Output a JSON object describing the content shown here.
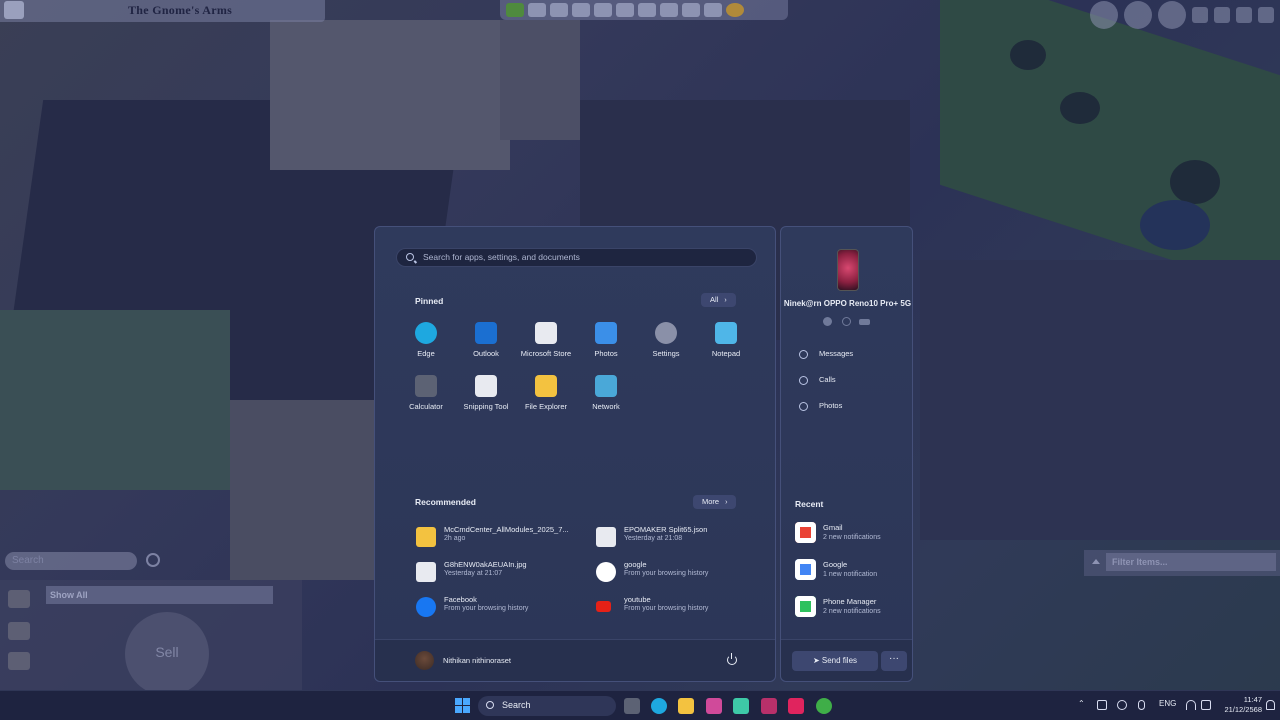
{
  "game": {
    "lot_name": "The Gnome's Arms",
    "search_placeholder": "Search",
    "filter_dropdown": "Show All",
    "sell_label": "Sell",
    "filter_placeholder": "Filter Items..."
  },
  "start_menu": {
    "search_placeholder": "Search for apps, settings, and documents",
    "pinned_title": "Pinned",
    "all_button": "All",
    "pinned_apps": [
      {
        "label": "Edge",
        "icon": "edge-icon",
        "color": "#1ea8e0"
      },
      {
        "label": "Outlook",
        "icon": "outlook-icon",
        "color": "#1b6fd1"
      },
      {
        "label": "Microsoft Store",
        "icon": "store-icon",
        "color": "#e8eaf0"
      },
      {
        "label": "Photos",
        "icon": "photos-icon",
        "color": "#3b8fe8"
      },
      {
        "label": "Settings",
        "icon": "settings-icon",
        "color": "#8a90a8"
      },
      {
        "label": "Notepad",
        "icon": "notepad-icon",
        "color": "#4fb6e8"
      },
      {
        "label": "Calculator",
        "icon": "calculator-icon",
        "color": "#5c6274"
      },
      {
        "label": "Snipping Tool",
        "icon": "snipping-tool-icon",
        "color": "#e8eaf0"
      },
      {
        "label": "File Explorer",
        "icon": "folder-icon",
        "color": "#f3c240"
      },
      {
        "label": "Network",
        "icon": "network-icon",
        "color": "#4aa8d8"
      }
    ],
    "recommended_title": "Recommended",
    "more_button": "More",
    "recommended": [
      {
        "title": "McCmdCenter_AllModules_2025_7...",
        "sub": "2h ago",
        "icon": "folder-icon",
        "color": "#f3c240"
      },
      {
        "title": "EPOMAKER Split65.json",
        "sub": "Yesterday at 21:08",
        "icon": "file-icon",
        "color": "#e8eaf0"
      },
      {
        "title": "G8hENW0akAEUAIn.jpg",
        "sub": "Yesterday at 21:07",
        "icon": "image-file-icon",
        "color": "#e8eaf0"
      },
      {
        "title": "google",
        "sub": "From your browsing history",
        "icon": "google-icon",
        "color": "#ffffff"
      },
      {
        "title": "Facebook",
        "sub": "From your browsing history",
        "icon": "facebook-icon",
        "color": "#1877f2"
      },
      {
        "title": "youtube",
        "sub": "From your browsing history",
        "icon": "youtube-icon",
        "color": "#e62117"
      }
    ],
    "user_name": "Nithikan nithinoraset"
  },
  "phone": {
    "device_name": "Ninek@rn OPPO Reno10 Pro+ 5G",
    "links": [
      {
        "label": "Messages",
        "icon": "messages-icon"
      },
      {
        "label": "Calls",
        "icon": "calls-icon"
      },
      {
        "label": "Photos",
        "icon": "photos-icon"
      }
    ],
    "recent_title": "Recent",
    "recent": [
      {
        "title": "Gmail",
        "sub": "2 new notifications",
        "icon": "gmail-icon",
        "color": "#ea4335"
      },
      {
        "title": "Google",
        "sub": "1 new notification",
        "icon": "google-icon",
        "color": "#4285f4"
      },
      {
        "title": "Phone Manager",
        "sub": "2 new notifications",
        "icon": "phone-manager-icon",
        "color": "#2ec15e"
      }
    ],
    "send_files": "Send files",
    "more": "···"
  },
  "taskbar": {
    "search_label": "Search",
    "language": "ENG",
    "time": "11:47",
    "date": "21/12/2568"
  }
}
